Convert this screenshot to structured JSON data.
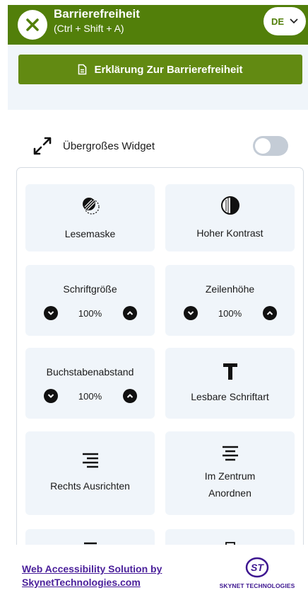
{
  "header": {
    "title": "Barrierefreiheit",
    "shortcut": "(Ctrl + Shift + A)",
    "language": "DE"
  },
  "explain_button": {
    "label": "Erklärung Zur Barrierefreiheit"
  },
  "oversize_widget": {
    "label": "Übergroßes Widget",
    "enabled": false
  },
  "tools": [
    {
      "label": "Lesemaske",
      "icon": "reading-mask-icon"
    },
    {
      "label": "Hoher Kontrast",
      "icon": "contrast-icon"
    },
    {
      "label": "Schriftgröße",
      "value": "100%"
    },
    {
      "label": "Zeilenhöhe",
      "value": "100%"
    },
    {
      "label": "Buchstabenabstand",
      "value": "100%"
    },
    {
      "label": "Lesbare Schriftart",
      "icon": "text-font-icon"
    },
    {
      "label": "Rechts Ausrichten",
      "icon": "align-right-icon"
    },
    {
      "label": "Im Zentrum Anordnen",
      "icon": "align-center-icon"
    }
  ],
  "footer": {
    "link_line1": "Web Accessibility Solution by",
    "link_line2": "SkynetTechnologies.com",
    "brand_name": "SKYNET TECHNOLOGIES",
    "brand_mark": "ST"
  },
  "colors": {
    "header_green": "#527f0a",
    "button_green": "#628a12",
    "card_bg": "#f0f5fa",
    "brand_purple": "#3d1690"
  }
}
